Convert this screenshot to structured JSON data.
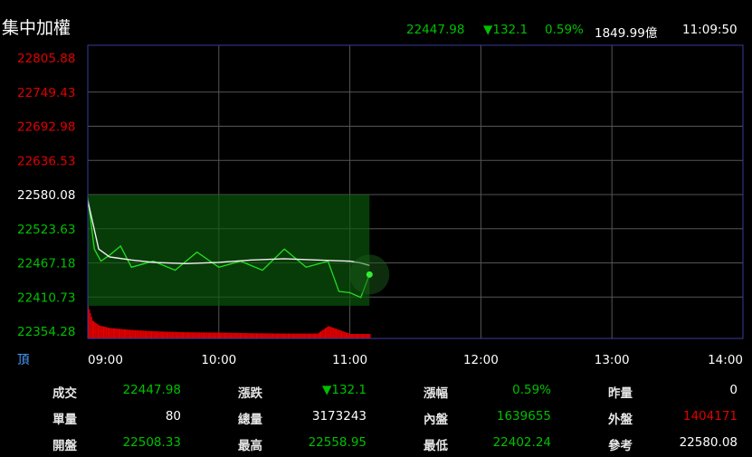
{
  "header": {
    "title": "集中加權",
    "index": "22447.98",
    "change": "▼132.1",
    "change_pct": "0.59%",
    "volume": "1849.99億",
    "time": "11:09:50"
  },
  "chart_data": {
    "type": "line",
    "title": "集中加權",
    "x_axis": {
      "ticks": [
        "09:00",
        "10:00",
        "11:00",
        "12:00",
        "13:00",
        "14:00"
      ],
      "range": [
        "09:00",
        "14:00"
      ]
    },
    "y_axis": {
      "ticks": [
        "22805.88",
        "22749.43",
        "22692.98",
        "22636.53",
        "22580.08",
        "22523.63",
        "22467.18",
        "22410.73",
        "22354.28"
      ],
      "range": [
        22354.28,
        22805.88
      ],
      "reference": 22580.08
    },
    "volume_axis_label": "頂",
    "grid": true,
    "series": [
      {
        "kind": "average",
        "x": [
          "09:00",
          "09:05",
          "09:10",
          "09:20",
          "09:30",
          "09:45",
          "10:00",
          "10:15",
          "10:30",
          "10:45",
          "11:00",
          "11:05",
          "11:09"
        ],
        "values": [
          22570,
          22490,
          22477,
          22472,
          22468,
          22466,
          22468,
          22472,
          22474,
          22472,
          22470,
          22467,
          22463
        ]
      },
      {
        "kind": "price",
        "x": [
          "09:00",
          "09:03",
          "09:06",
          "09:10",
          "09:15",
          "09:20",
          "09:30",
          "09:40",
          "09:50",
          "10:00",
          "10:10",
          "10:20",
          "10:30",
          "10:40",
          "10:50",
          "10:55",
          "11:00",
          "11:05",
          "11:09"
        ],
        "values": [
          22575,
          22490,
          22470,
          22480,
          22495,
          22460,
          22470,
          22455,
          22485,
          22460,
          22470,
          22455,
          22490,
          22460,
          22470,
          22420,
          22418,
          22410,
          22447.98
        ]
      }
    ],
    "volume": {
      "x": [
        "09:00",
        "09:02",
        "09:05",
        "09:10",
        "09:20",
        "09:30",
        "09:45",
        "10:00",
        "10:15",
        "10:30",
        "10:45",
        "10:50",
        "11:00",
        "11:09"
      ],
      "values": [
        100,
        55,
        40,
        32,
        26,
        22,
        19,
        18,
        16,
        15,
        15,
        38,
        14,
        14
      ]
    }
  },
  "info": [
    [
      {
        "label": "成交",
        "value": "22447.98",
        "color": "#00c000"
      },
      {
        "label": "漲跌",
        "value": "▼132.1",
        "color": "#00c000"
      },
      {
        "label": "漲幅",
        "value": "0.59%",
        "color": "#00c000"
      },
      {
        "label": "昨量",
        "value": "0",
        "color": "#ffffff"
      }
    ],
    [
      {
        "label": "單量",
        "value": "80",
        "color": "#ffffff"
      },
      {
        "label": "總量",
        "value": "3173243",
        "color": "#ffffff"
      },
      {
        "label": "內盤",
        "value": "1639655",
        "color": "#00c000"
      },
      {
        "label": "外盤",
        "value": "1404171",
        "color": "#e00000"
      }
    ],
    [
      {
        "label": "開盤",
        "value": "22508.33",
        "color": "#00c000"
      },
      {
        "label": "最高",
        "value": "22558.95",
        "color": "#00c000"
      },
      {
        "label": "最低",
        "value": "22402.24",
        "color": "#00c000"
      },
      {
        "label": "參考",
        "value": "22580.08",
        "color": "#ffffff"
      }
    ]
  ],
  "colors": {
    "up": "#e00000",
    "down": "#00c000",
    "grid": "#555555",
    "frame": "#3a3aa0",
    "axis_label": "#4aa0ff"
  }
}
